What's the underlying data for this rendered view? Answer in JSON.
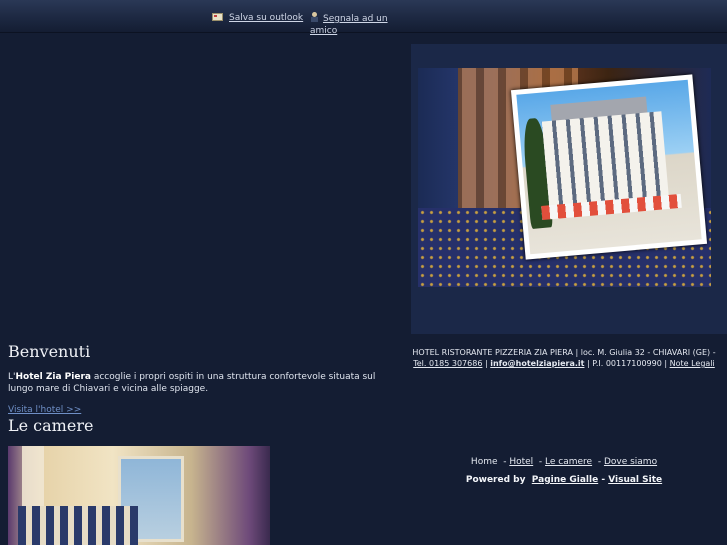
{
  "top_links": {
    "outlook": "Salva su outlook",
    "amico": "Segnala ad un amico"
  },
  "welcome": {
    "title": "Benvenuti",
    "text_prefix": "L'",
    "hotel_name": "Hotel Zia Piera",
    "text_body": " accoglie i propri ospiti in una struttura confortevole situata sul lungo mare di Chiavari e vicina alle spiagge.",
    "visit_link": "Visita l'hotel >>"
  },
  "rooms": {
    "title": "Le camere"
  },
  "footer": {
    "address_line": "HOTEL RISTORANTE PIZZERIA ZIA PIERA | loc. M. Giulia 32 - CHIAVARI (GE) -",
    "phone": "Tel. 0185 307686",
    "email": "info@hotelziapiera.it",
    "vat": "P.I. 00117100990",
    "legal": "Note Legali",
    "nav": {
      "home": "Home",
      "hotel": "Hotel",
      "camere": "Le camere",
      "dove": "Dove siamo"
    },
    "powered_label": "Powered by",
    "powered_pagine": "Pagine Gialle",
    "powered_visual": "Visual Site"
  },
  "colors": {
    "background": "#141d33",
    "panel": "#1b2848",
    "link": "#6f8fc6"
  }
}
